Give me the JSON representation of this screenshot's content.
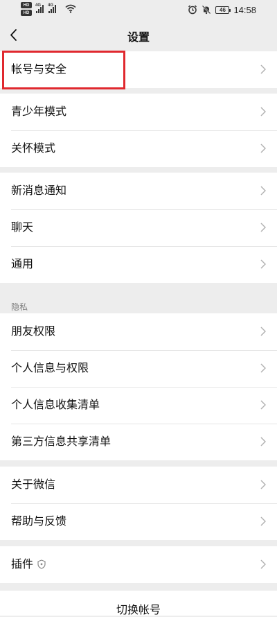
{
  "status_bar": {
    "hd1": "HD",
    "hd2": "HD",
    "net1": "4G",
    "net2": "4G",
    "battery": "46",
    "time": "14:58"
  },
  "header": {
    "title": "设置"
  },
  "groups": [
    {
      "items": [
        {
          "label": "帐号与安全"
        }
      ]
    },
    {
      "items": [
        {
          "label": "青少年模式"
        },
        {
          "label": "关怀模式"
        }
      ]
    },
    {
      "items": [
        {
          "label": "新消息通知"
        },
        {
          "label": "聊天"
        },
        {
          "label": "通用"
        }
      ]
    },
    {
      "header": "隐私",
      "items": [
        {
          "label": "朋友权限"
        },
        {
          "label": "个人信息与权限"
        },
        {
          "label": "个人信息收集清单"
        },
        {
          "label": "第三方信息共享清单"
        }
      ]
    },
    {
      "items": [
        {
          "label": "关于微信"
        },
        {
          "label": "帮助与反馈"
        }
      ]
    },
    {
      "items": [
        {
          "label": "插件"
        }
      ]
    }
  ],
  "footer": {
    "switch_account": "切换帐号"
  },
  "icons": {
    "back": "chevron-left-icon",
    "row_arrow": "chevron-right-icon",
    "plugin_badge": "shield-icon",
    "alarm": "alarm-icon",
    "mute": "bell-off-icon",
    "wifi": "wifi-icon"
  },
  "colors": {
    "background": "#ededed",
    "highlight_border": "#e0282e",
    "section_header_text": "#7f7f7f"
  }
}
